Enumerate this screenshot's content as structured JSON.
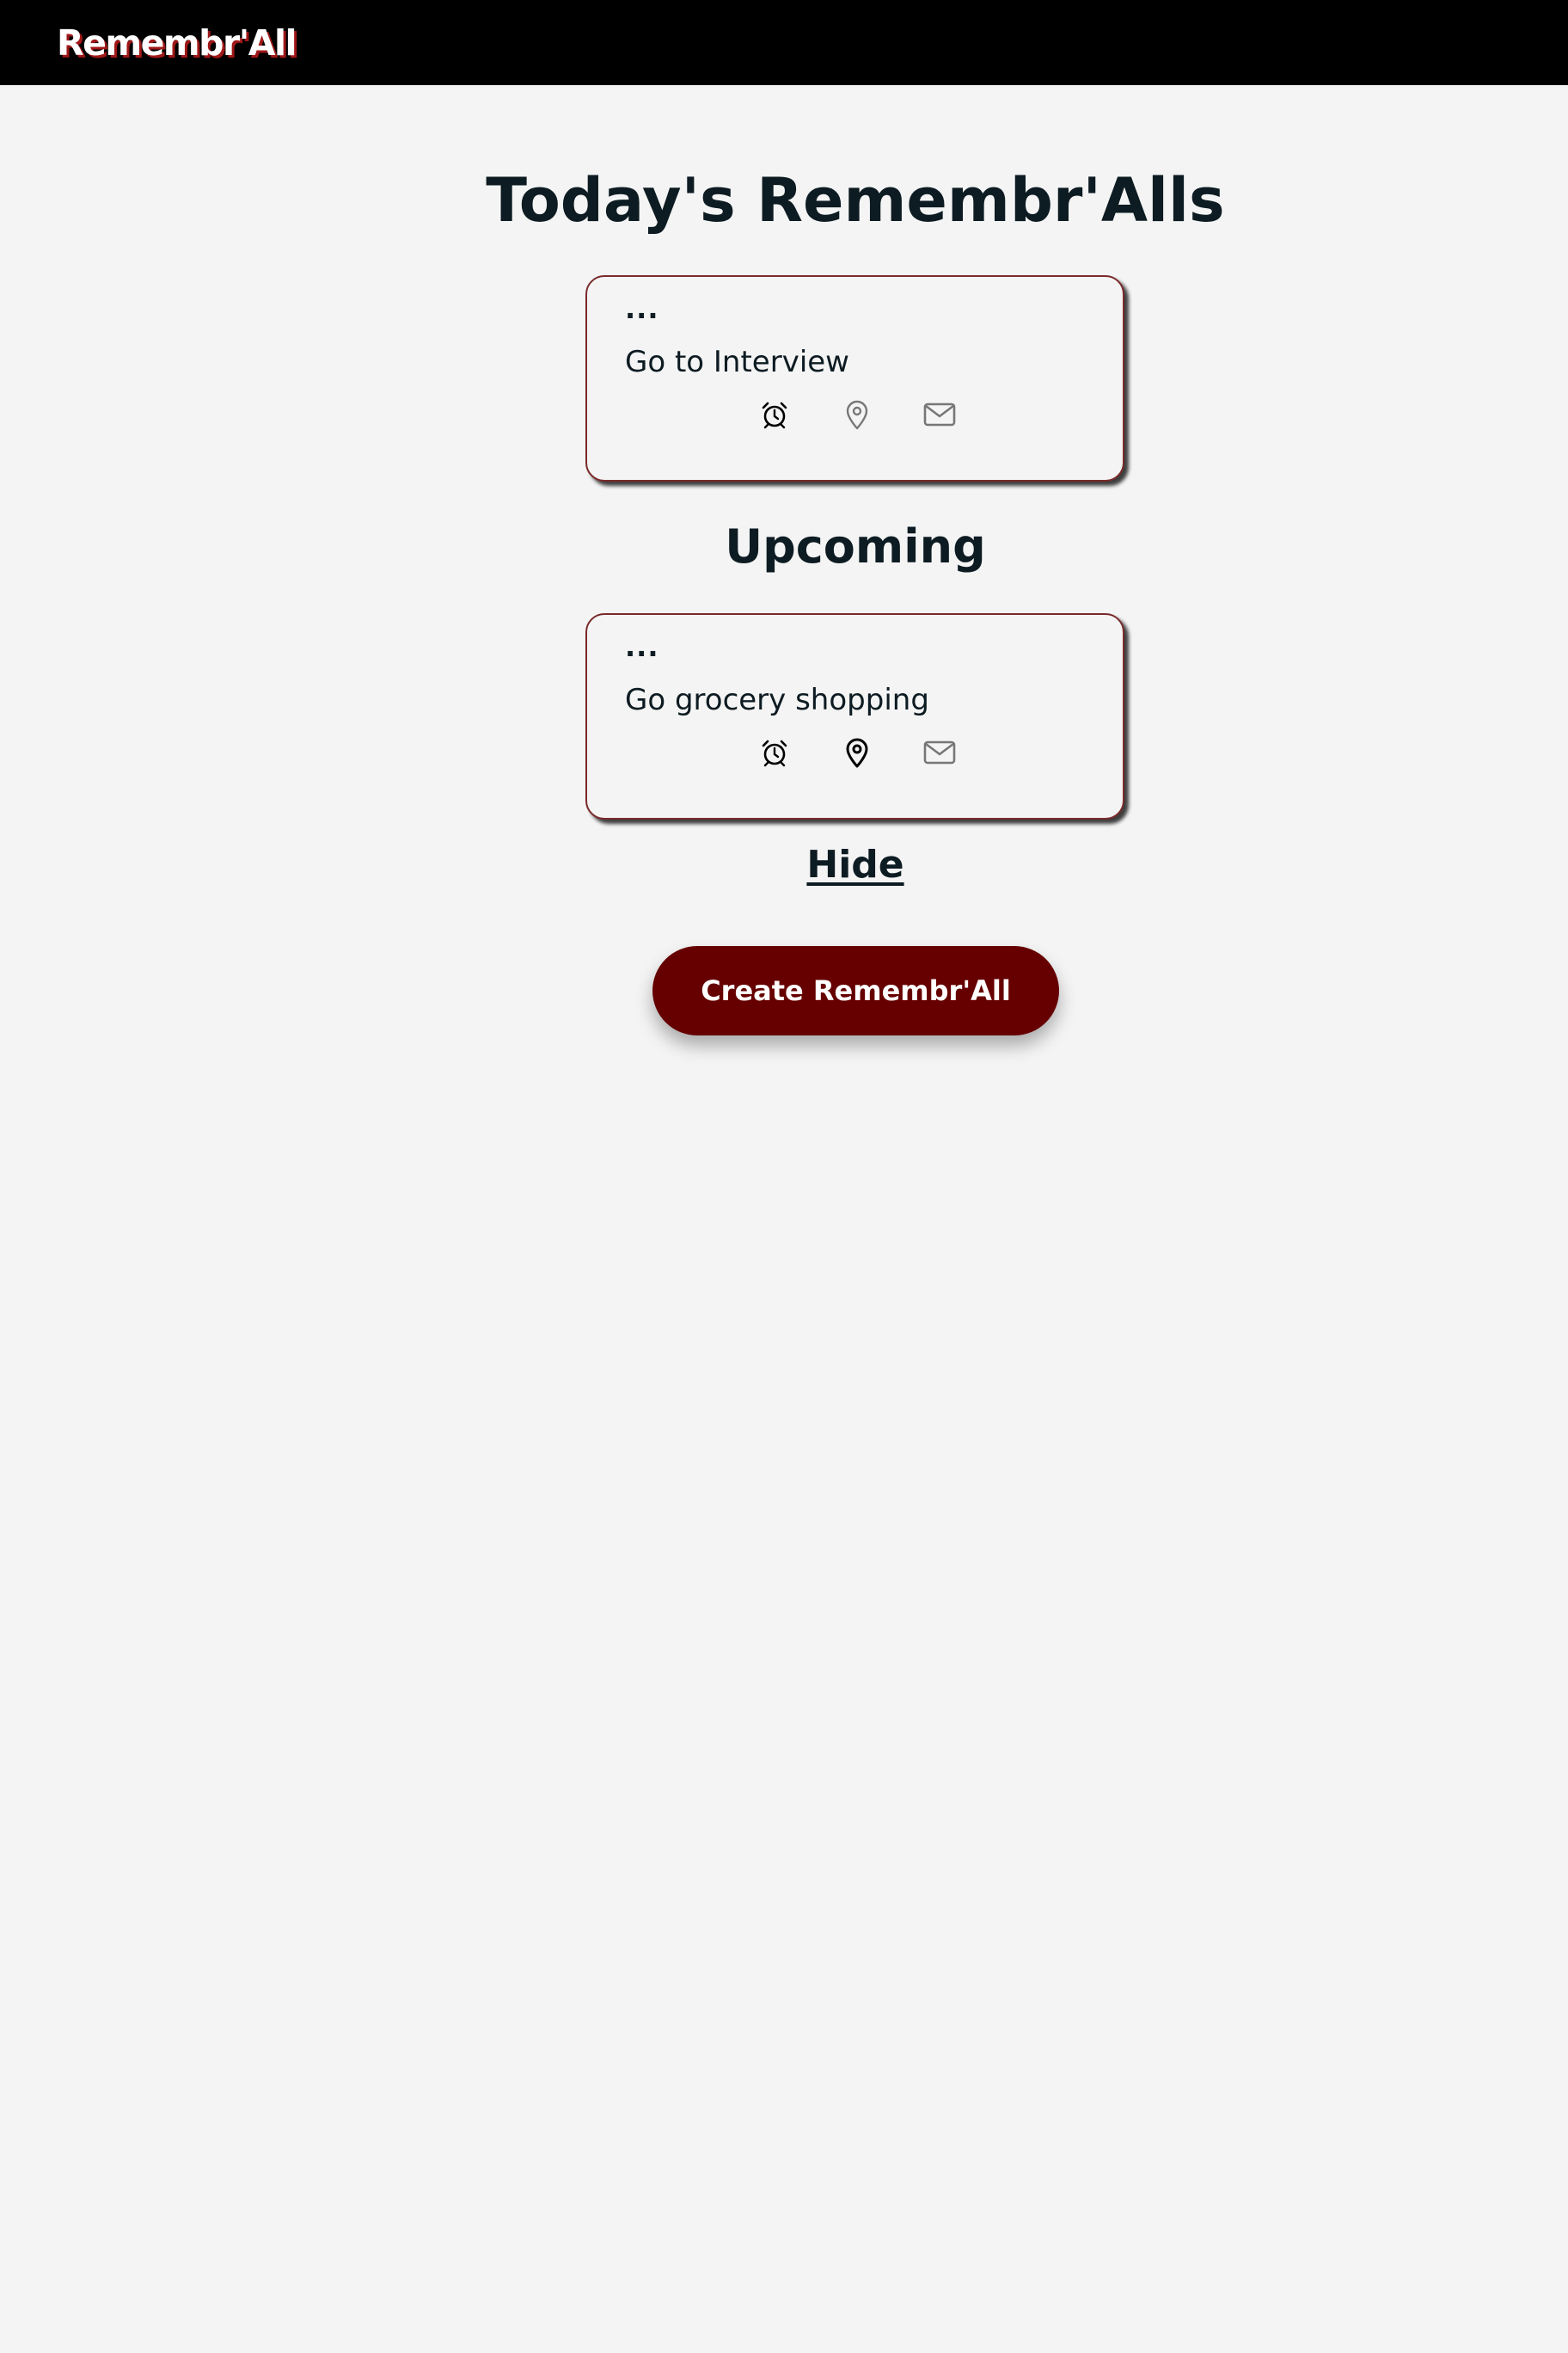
{
  "header": {
    "brand": "Remembr'All"
  },
  "main": {
    "title": "Today's Remembr'Alls",
    "upcoming_title": "Upcoming",
    "hide_label": "Hide",
    "create_label": "Create Remembr'All"
  },
  "today": [
    {
      "menu": "...",
      "title": "Go to Interview",
      "icons": {
        "alarm": {
          "name": "alarm-clock-icon",
          "active": true
        },
        "location": {
          "name": "map-pin-icon",
          "active": false
        },
        "email": {
          "name": "envelope-icon",
          "active": false
        }
      }
    }
  ],
  "upcoming": [
    {
      "menu": "...",
      "title": "Go grocery shopping",
      "icons": {
        "alarm": {
          "name": "alarm-clock-icon",
          "active": true
        },
        "location": {
          "name": "map-pin-icon",
          "active": true
        },
        "email": {
          "name": "envelope-icon",
          "active": false
        }
      }
    }
  ],
  "colors": {
    "header_bg": "#000000",
    "page_bg": "#f4f4f4",
    "accent": "#660000",
    "card_border": "#7a2a2a",
    "text": "#0d1b22",
    "icon_active": "#000000",
    "icon_inactive": "#777777"
  }
}
